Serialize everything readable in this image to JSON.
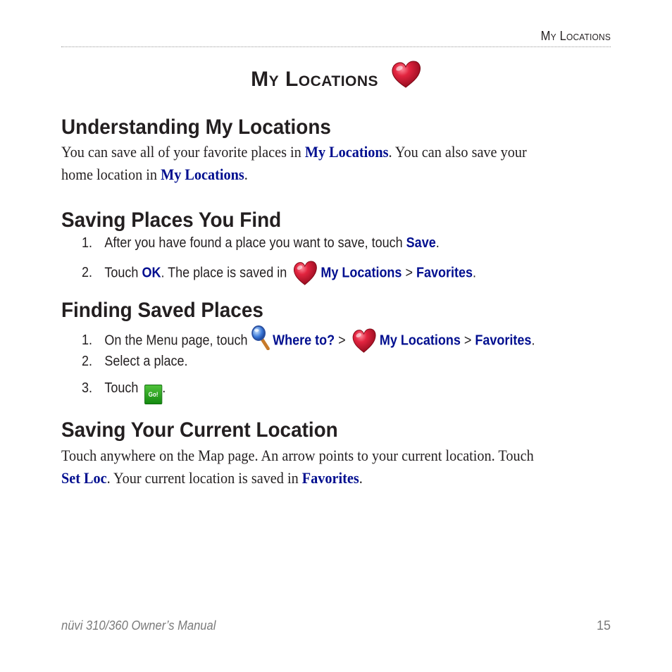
{
  "header": {
    "running_head": "My Locations"
  },
  "chapter": {
    "title": "My Locations",
    "icon": "heart-icon"
  },
  "sections": [
    {
      "heading": "Understanding My Locations",
      "paragraph": {
        "line1_a": "You can save all of your favorite places in ",
        "line1_ui": "My Locations",
        "line1_b": ". You can also save your",
        "line2_a": "home location in ",
        "line2_ui": "My Locations",
        "line2_b": "."
      }
    },
    {
      "heading": "Saving Places You Find",
      "steps": [
        {
          "num": "1.",
          "text_a": "After you have found a place you want to save, touch ",
          "ui1": "Save",
          "text_b": "."
        },
        {
          "num": "2.",
          "text_a": "Touch ",
          "ui1": "OK",
          "text_b": ". The place is saved in ",
          "icon": "heart-icon",
          "ui2": "My Locations",
          "sep": " > ",
          "ui3": "Favorites",
          "text_c": "."
        }
      ]
    },
    {
      "heading": "Finding Saved Places",
      "steps": [
        {
          "num": "1.",
          "text_a": "On the Menu page, touch ",
          "icon1": "magnifier-icon",
          "ui1": "Where to?",
          "sep1": " > ",
          "icon2": "heart-icon",
          "ui2": "My Locations",
          "sep2": " > ",
          "ui3": "Favorites",
          "text_b": "."
        },
        {
          "num": "2.",
          "text_a": "Select a place."
        },
        {
          "num": "3.",
          "text_a": "Touch ",
          "button_label": "Go!",
          "text_b": "."
        }
      ]
    },
    {
      "heading": "Saving Your Current Location",
      "paragraph": {
        "line1_a": "Touch anywhere on the Map page. An arrow points to your current location. Touch",
        "line2_ui1": "Set Loc",
        "line2_a": ". Your current location is saved in ",
        "line2_ui2": "Favorites",
        "line2_b": "."
      }
    }
  ],
  "footer": {
    "manual_title": "nüvi 310/360 Owner’s Manual",
    "page_number": "15"
  },
  "colors": {
    "ui_text": "#000e8f",
    "body_text": "#231f20",
    "footer_text": "#7a7a7a",
    "go_button": "#1fa01a",
    "heart": "#d81e3c"
  }
}
